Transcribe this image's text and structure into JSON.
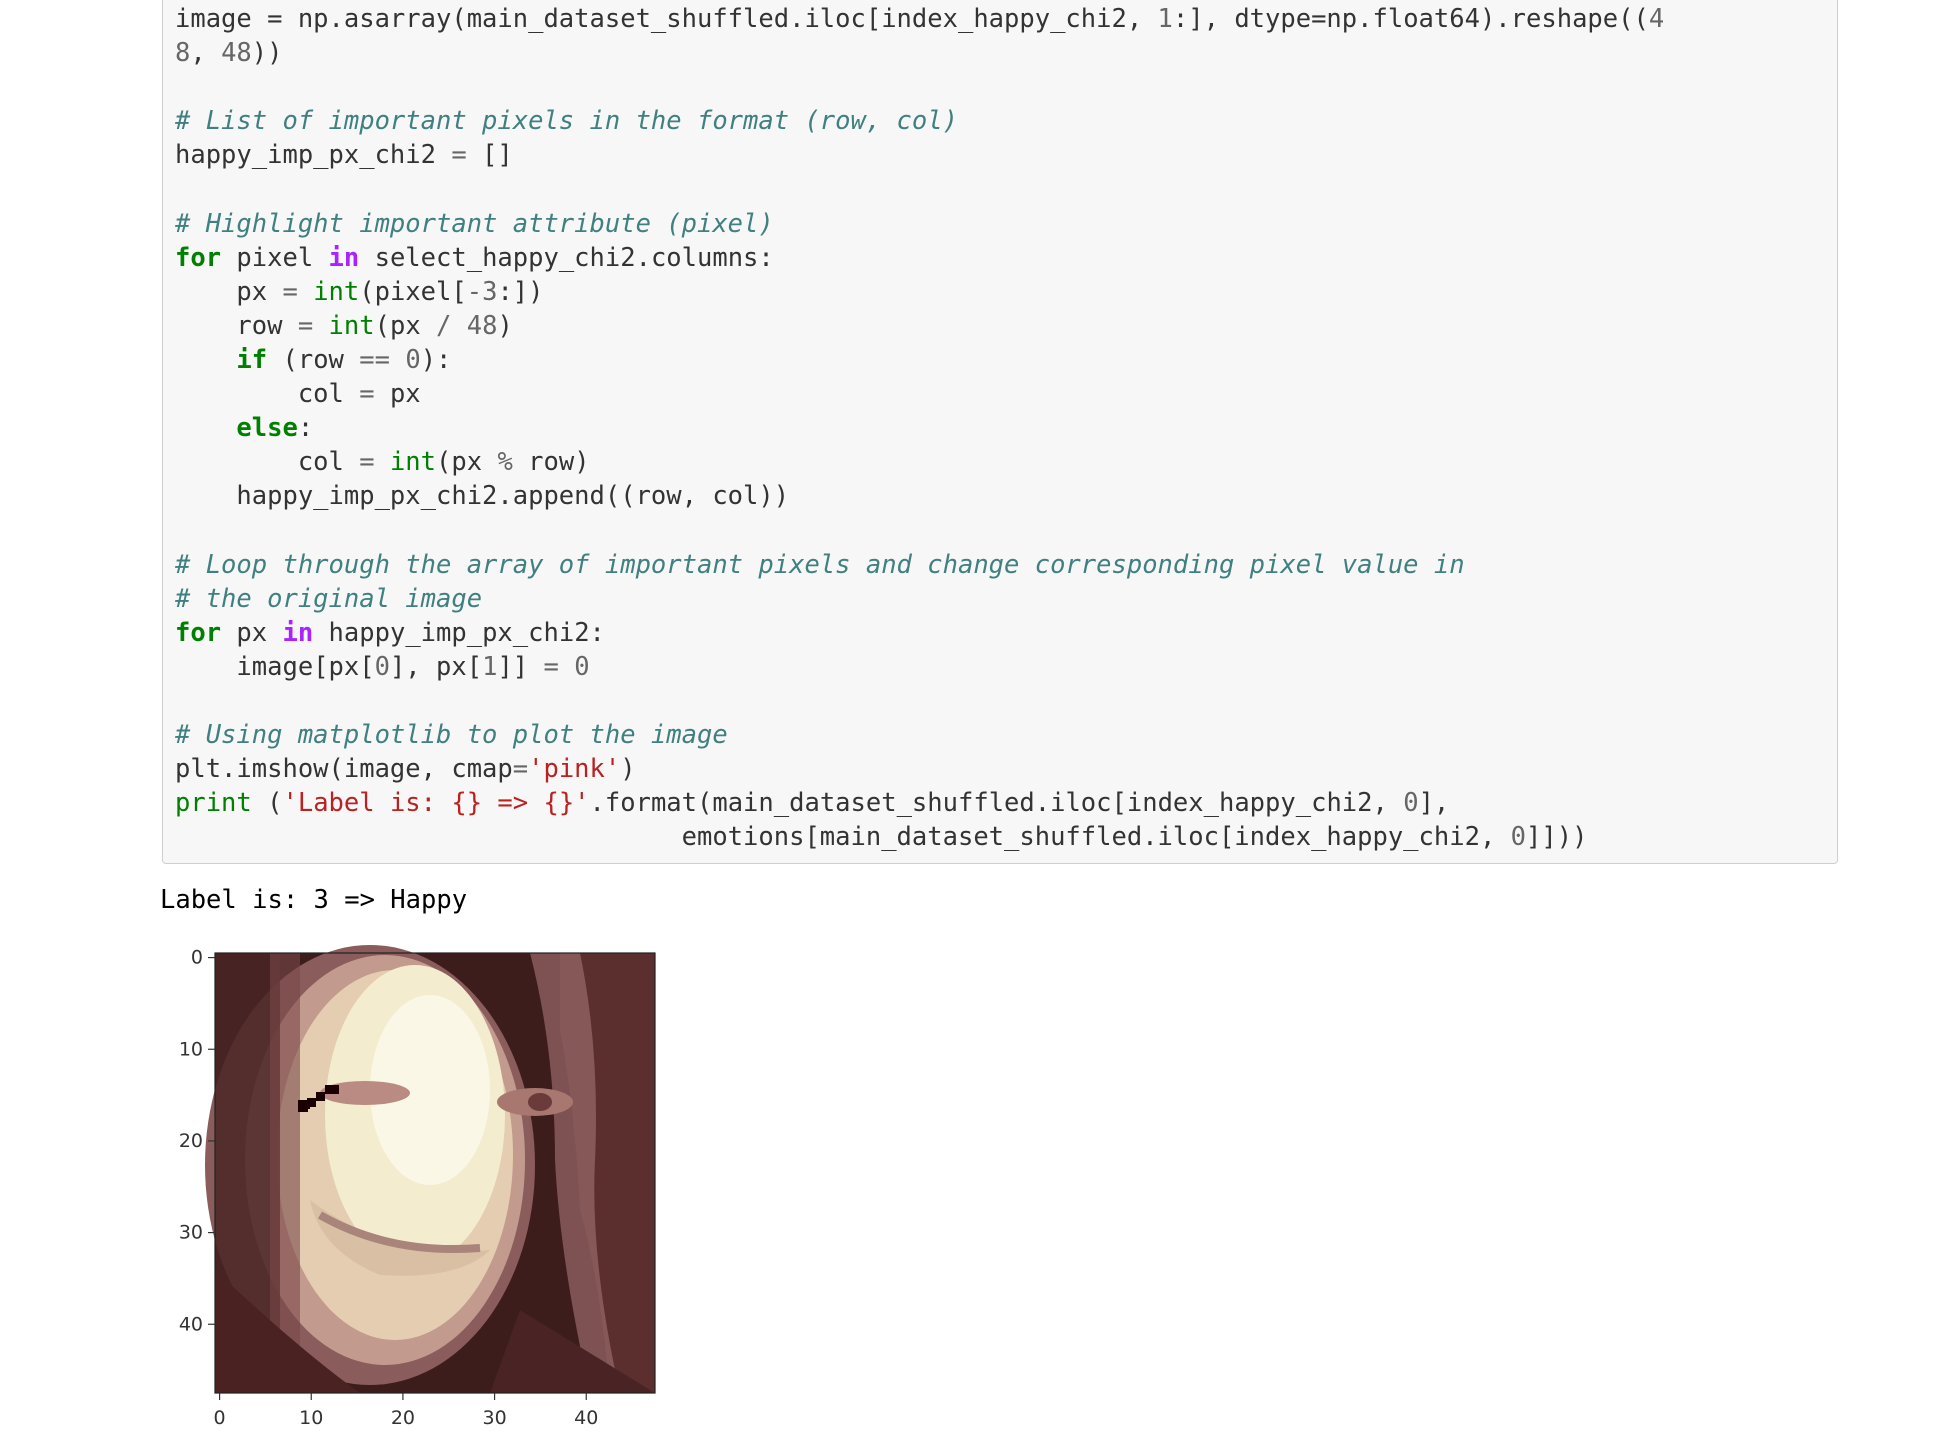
{
  "code_cell": {
    "lines": [
      {
        "segs": [
          [
            "",
            "image = np.asarray(main_dataset_shuffled.iloc[index_happy_chi2, "
          ],
          [
            "nm",
            "1"
          ],
          [
            "",
            ":], dtype=np.float64).reshape(("
          ],
          [
            "nm",
            "4"
          ]
        ]
      },
      {
        "segs": [
          [
            "nm",
            "8"
          ],
          [
            "",
            ", "
          ],
          [
            "nm",
            "48"
          ],
          [
            "",
            "))"
          ]
        ]
      },
      {
        "segs": []
      },
      {
        "segs": [
          [
            "cm",
            "# List of important pixels in the format (row, col)"
          ]
        ]
      },
      {
        "segs": [
          [
            "",
            "happy_imp_px_chi2 "
          ],
          [
            "op",
            "="
          ],
          [
            "",
            " []"
          ]
        ]
      },
      {
        "segs": []
      },
      {
        "segs": [
          [
            "cm",
            "# Highlight important attribute (pixel)"
          ]
        ]
      },
      {
        "segs": [
          [
            "kw",
            "for"
          ],
          [
            "",
            " pixel "
          ],
          [
            "ow",
            "in"
          ],
          [
            "",
            " select_happy_chi2.columns:"
          ]
        ]
      },
      {
        "segs": [
          [
            "",
            "    px "
          ],
          [
            "op",
            "="
          ],
          [
            "",
            " "
          ],
          [
            "bi",
            "int"
          ],
          [
            "",
            "(pixel["
          ],
          [
            "op",
            "-"
          ],
          [
            "nm",
            "3"
          ],
          [
            "",
            ":])"
          ]
        ]
      },
      {
        "segs": [
          [
            "",
            "    row "
          ],
          [
            "op",
            "="
          ],
          [
            "",
            " "
          ],
          [
            "bi",
            "int"
          ],
          [
            "",
            "(px "
          ],
          [
            "op",
            "/"
          ],
          [
            "",
            " "
          ],
          [
            "nm",
            "48"
          ],
          [
            "",
            ")"
          ]
        ]
      },
      {
        "segs": [
          [
            "",
            "    "
          ],
          [
            "kw",
            "if"
          ],
          [
            "",
            " (row "
          ],
          [
            "op",
            "=="
          ],
          [
            "",
            " "
          ],
          [
            "nm",
            "0"
          ],
          [
            "",
            "):"
          ]
        ]
      },
      {
        "segs": [
          [
            "",
            "        col "
          ],
          [
            "op",
            "="
          ],
          [
            "",
            " px"
          ]
        ]
      },
      {
        "segs": [
          [
            "",
            "    "
          ],
          [
            "kw",
            "else"
          ],
          [
            "",
            ":"
          ]
        ]
      },
      {
        "segs": [
          [
            "",
            "        col "
          ],
          [
            "op",
            "="
          ],
          [
            "",
            " "
          ],
          [
            "bi",
            "int"
          ],
          [
            "",
            "(px "
          ],
          [
            "op",
            "%"
          ],
          [
            "",
            " row)"
          ]
        ]
      },
      {
        "segs": [
          [
            "",
            "    happy_imp_px_chi2.append((row, col))"
          ]
        ]
      },
      {
        "segs": []
      },
      {
        "segs": [
          [
            "cm",
            "# Loop through the array of important pixels and change corresponding pixel value in"
          ]
        ]
      },
      {
        "segs": [
          [
            "cm",
            "# the original image"
          ]
        ]
      },
      {
        "segs": [
          [
            "kw",
            "for"
          ],
          [
            "",
            " px "
          ],
          [
            "ow",
            "in"
          ],
          [
            "",
            " happy_imp_px_chi2:"
          ]
        ]
      },
      {
        "segs": [
          [
            "",
            "    image[px["
          ],
          [
            "nm",
            "0"
          ],
          [
            "",
            "], px["
          ],
          [
            "nm",
            "1"
          ],
          [
            "",
            "]] "
          ],
          [
            "op",
            "="
          ],
          [
            "",
            " "
          ],
          [
            "nm",
            "0"
          ]
        ]
      },
      {
        "segs": []
      },
      {
        "segs": [
          [
            "cm",
            "# Using matplotlib to plot the image"
          ]
        ]
      },
      {
        "segs": [
          [
            "",
            "plt.imshow(image, cmap"
          ],
          [
            "op",
            "="
          ],
          [
            "st",
            "'pink'"
          ],
          [
            "",
            ")"
          ]
        ]
      },
      {
        "segs": [
          [
            "bi",
            "print"
          ],
          [
            "",
            " ("
          ],
          [
            "st",
            "'Label is: {} => {}'"
          ],
          [
            "",
            ".format(main_dataset_shuffled.iloc[index_happy_chi2, "
          ],
          [
            "nm",
            "0"
          ],
          [
            "",
            "],"
          ]
        ]
      },
      {
        "segs": [
          [
            "",
            "                                 emotions[main_dataset_shuffled.iloc[index_happy_chi2, "
          ],
          [
            "nm",
            "0"
          ],
          [
            "",
            "]]))"
          ]
        ]
      }
    ]
  },
  "output": {
    "text": "Label is: 3 => Happy"
  },
  "plot": {
    "cmap": "pink",
    "x_ticks": [
      "0",
      "10",
      "20",
      "30",
      "40"
    ],
    "y_ticks": [
      "0",
      "10",
      "20",
      "30",
      "40"
    ],
    "grid_size": [
      48,
      48
    ],
    "highlighted_pixels_value": 0
  }
}
